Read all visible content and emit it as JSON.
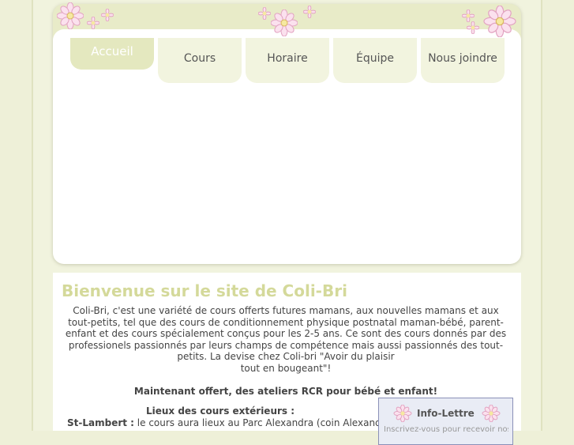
{
  "nav": {
    "tabs": [
      {
        "label": "Accueil"
      },
      {
        "label": "Cours"
      },
      {
        "label": "Horaire"
      },
      {
        "label": "Équipe"
      },
      {
        "label": "Nous joindre"
      }
    ]
  },
  "main": {
    "title": "Bienvenue sur le site de Coli-Bri",
    "intro": "Coli-Bri, c'est une variété de cours offerts futures mamans, aux nouvelles mamans et aux tout-petits, tel que des cours de conditionnement physique postnatal maman-bébé, parent-enfant et des cours spécialement conçus pour les 2-5 ans.  Ce sont des cours donnés par des professionels passionnés par leurs champs de compétence mais aussi passionnés des tout-petits.  La devise chez Coli-bri  \"Avoir du plaisir",
    "intro_end": "tout en bougeant\"!",
    "rcr": "Maintenant offert, des ateliers RCR pour bébé et enfant!",
    "lieux_title": "Lieux des cours extérieurs :",
    "stlambert_label": "St-Lambert :",
    "stlambert_text": " le cours aura lieux au Parc Alexandra (coin Alexandra"
  },
  "infolettre": {
    "title": "Info-Lettre",
    "subtitle": "Inscrivez-vous pour recevoir nos infos"
  },
  "colors": {
    "accent": "#d4d99a",
    "tab_bg": "#f2f4df",
    "tab_active": "#e4e8bf",
    "flower_pink": "#f4b8d4"
  },
  "icons": [
    "daisy-flower-icon"
  ]
}
